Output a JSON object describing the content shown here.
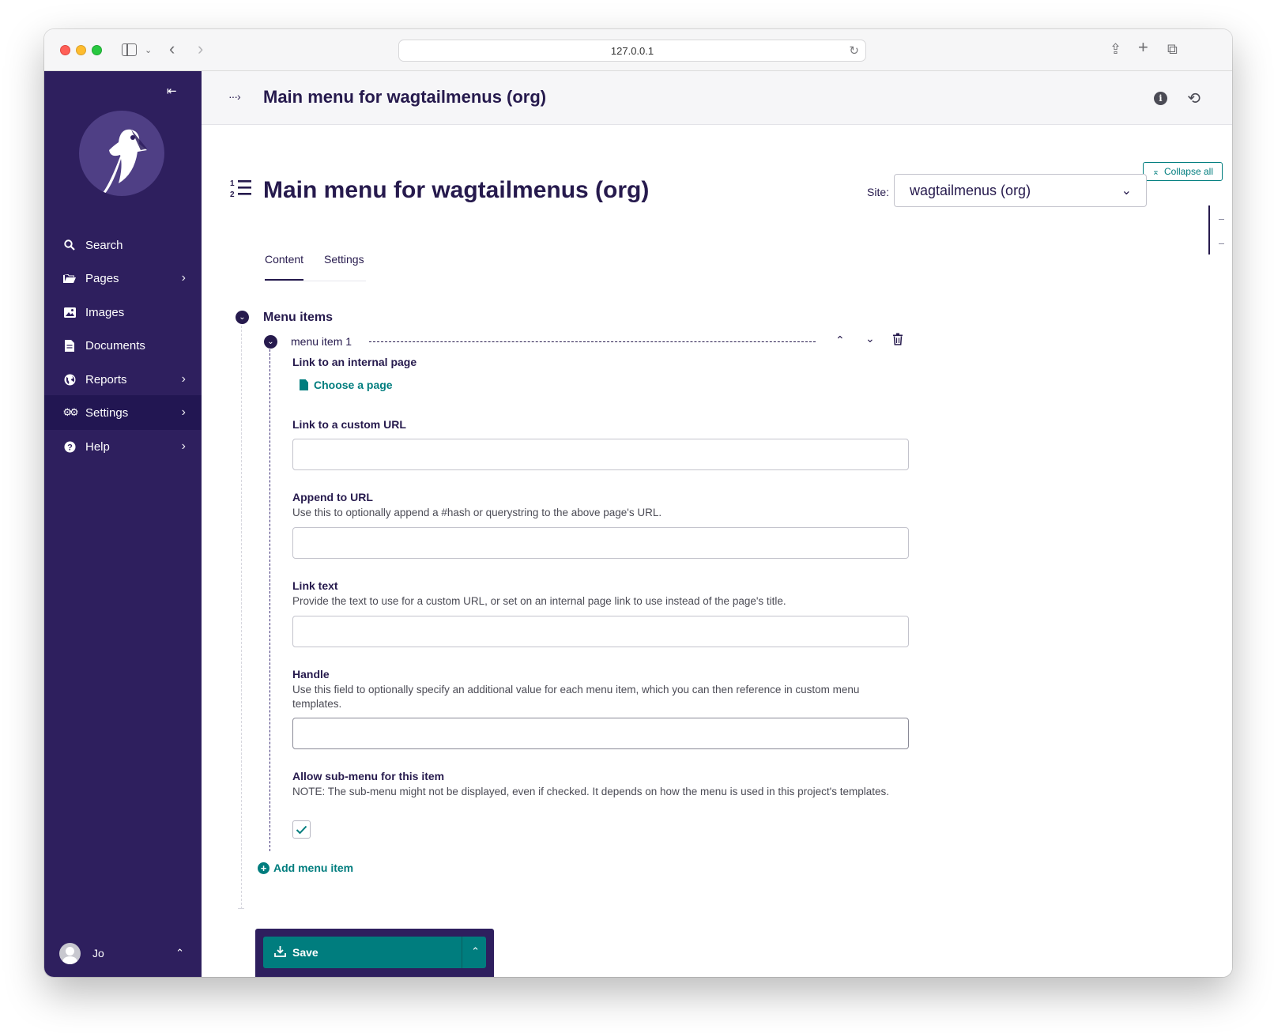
{
  "browser": {
    "url": "127.0.0.1"
  },
  "sidebar": {
    "items": [
      {
        "label": "Search",
        "icon": "search-icon",
        "has_children": false
      },
      {
        "label": "Pages",
        "icon": "folder-icon",
        "has_children": true
      },
      {
        "label": "Images",
        "icon": "image-icon",
        "has_children": false
      },
      {
        "label": "Documents",
        "icon": "document-icon",
        "has_children": false
      },
      {
        "label": "Reports",
        "icon": "globe-icon",
        "has_children": true
      },
      {
        "label": "Settings",
        "icon": "cogs-icon",
        "has_children": true,
        "active": true
      },
      {
        "label": "Help",
        "icon": "help-icon",
        "has_children": true
      }
    ],
    "user": {
      "name": "Jo"
    }
  },
  "header": {
    "title": "Main menu for wagtailmenus (org)"
  },
  "page": {
    "title": "Main menu for wagtailmenus (org)",
    "collapse_all": "Collapse all",
    "site_label": "Site:",
    "site_value": "wagtailmenus (org)"
  },
  "tabs": [
    {
      "label": "Content",
      "active": true
    },
    {
      "label": "Settings",
      "active": false
    }
  ],
  "section": {
    "title": "Menu items",
    "item": {
      "title": "menu item 1",
      "internal_page": {
        "label": "Link to an internal page",
        "button": "Choose a page"
      },
      "custom_url": {
        "label": "Link to a custom URL",
        "value": ""
      },
      "append_url": {
        "label": "Append to URL",
        "help": "Use this to optionally append a #hash or querystring to the above page's URL.",
        "value": ""
      },
      "link_text": {
        "label": "Link text",
        "help": "Provide the text to use for a custom URL, or set on an internal page link to use instead of the page's title.",
        "value": ""
      },
      "handle": {
        "label": "Handle",
        "help": "Use this field to optionally specify an additional value for each menu item, which you can then reference in custom menu templates.",
        "value": ""
      },
      "allow_submenu": {
        "label": "Allow sub-menu for this item",
        "help": "NOTE: The sub-menu might not be displayed, even if checked. It depends on how the menu is used in this project's templates.",
        "checked": true
      }
    },
    "add_button": "Add menu item"
  },
  "footer": {
    "save_label": "Save"
  },
  "colors": {
    "sidebar": "#2e1f5e",
    "primary_text": "#261a4d",
    "accent": "#007d7e"
  }
}
